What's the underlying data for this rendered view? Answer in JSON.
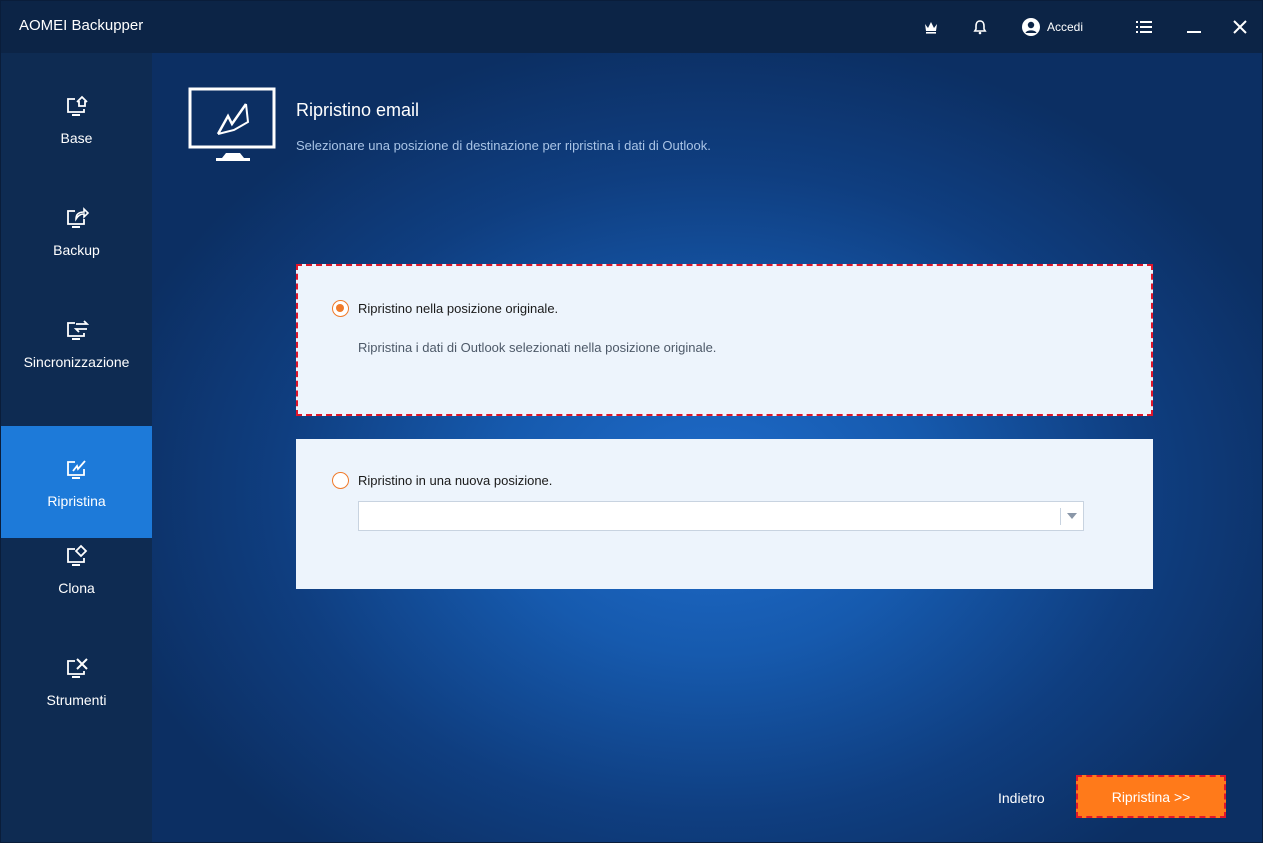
{
  "app": {
    "title": "AOMEI Backupper"
  },
  "titlebar": {
    "login_label": "Accedi"
  },
  "sidebar": {
    "items": [
      {
        "label": "Base",
        "icon": "monitor-home-icon"
      },
      {
        "label": "Backup",
        "icon": "monitor-backup-icon"
      },
      {
        "label": "Sincronizzazione",
        "icon": "monitor-sync-icon"
      },
      {
        "label": "Ripristina",
        "icon": "monitor-restore-icon",
        "active": true
      },
      {
        "label": "Clona",
        "icon": "monitor-clone-icon"
      },
      {
        "label": "Strumenti",
        "icon": "monitor-tools-icon"
      }
    ]
  },
  "main": {
    "title": "Ripristino email",
    "subtitle": "Selezionare una posizione di destinazione per ripristina i dati di Outlook.",
    "option_original": {
      "label": "Ripristino nella posizione originale.",
      "description": "Ripristina i dati di Outlook selezionati nella posizione originale.",
      "selected": true
    },
    "option_new": {
      "label": "Ripristino in una nuova posizione.",
      "selected": false,
      "destination_value": ""
    },
    "back_label": "Indietro",
    "restore_label": "Ripristina >>"
  },
  "colors": {
    "accent_orange": "#ff7a1a",
    "active_nav": "#1d7ad9",
    "highlight_dashed": "#e0162b"
  }
}
